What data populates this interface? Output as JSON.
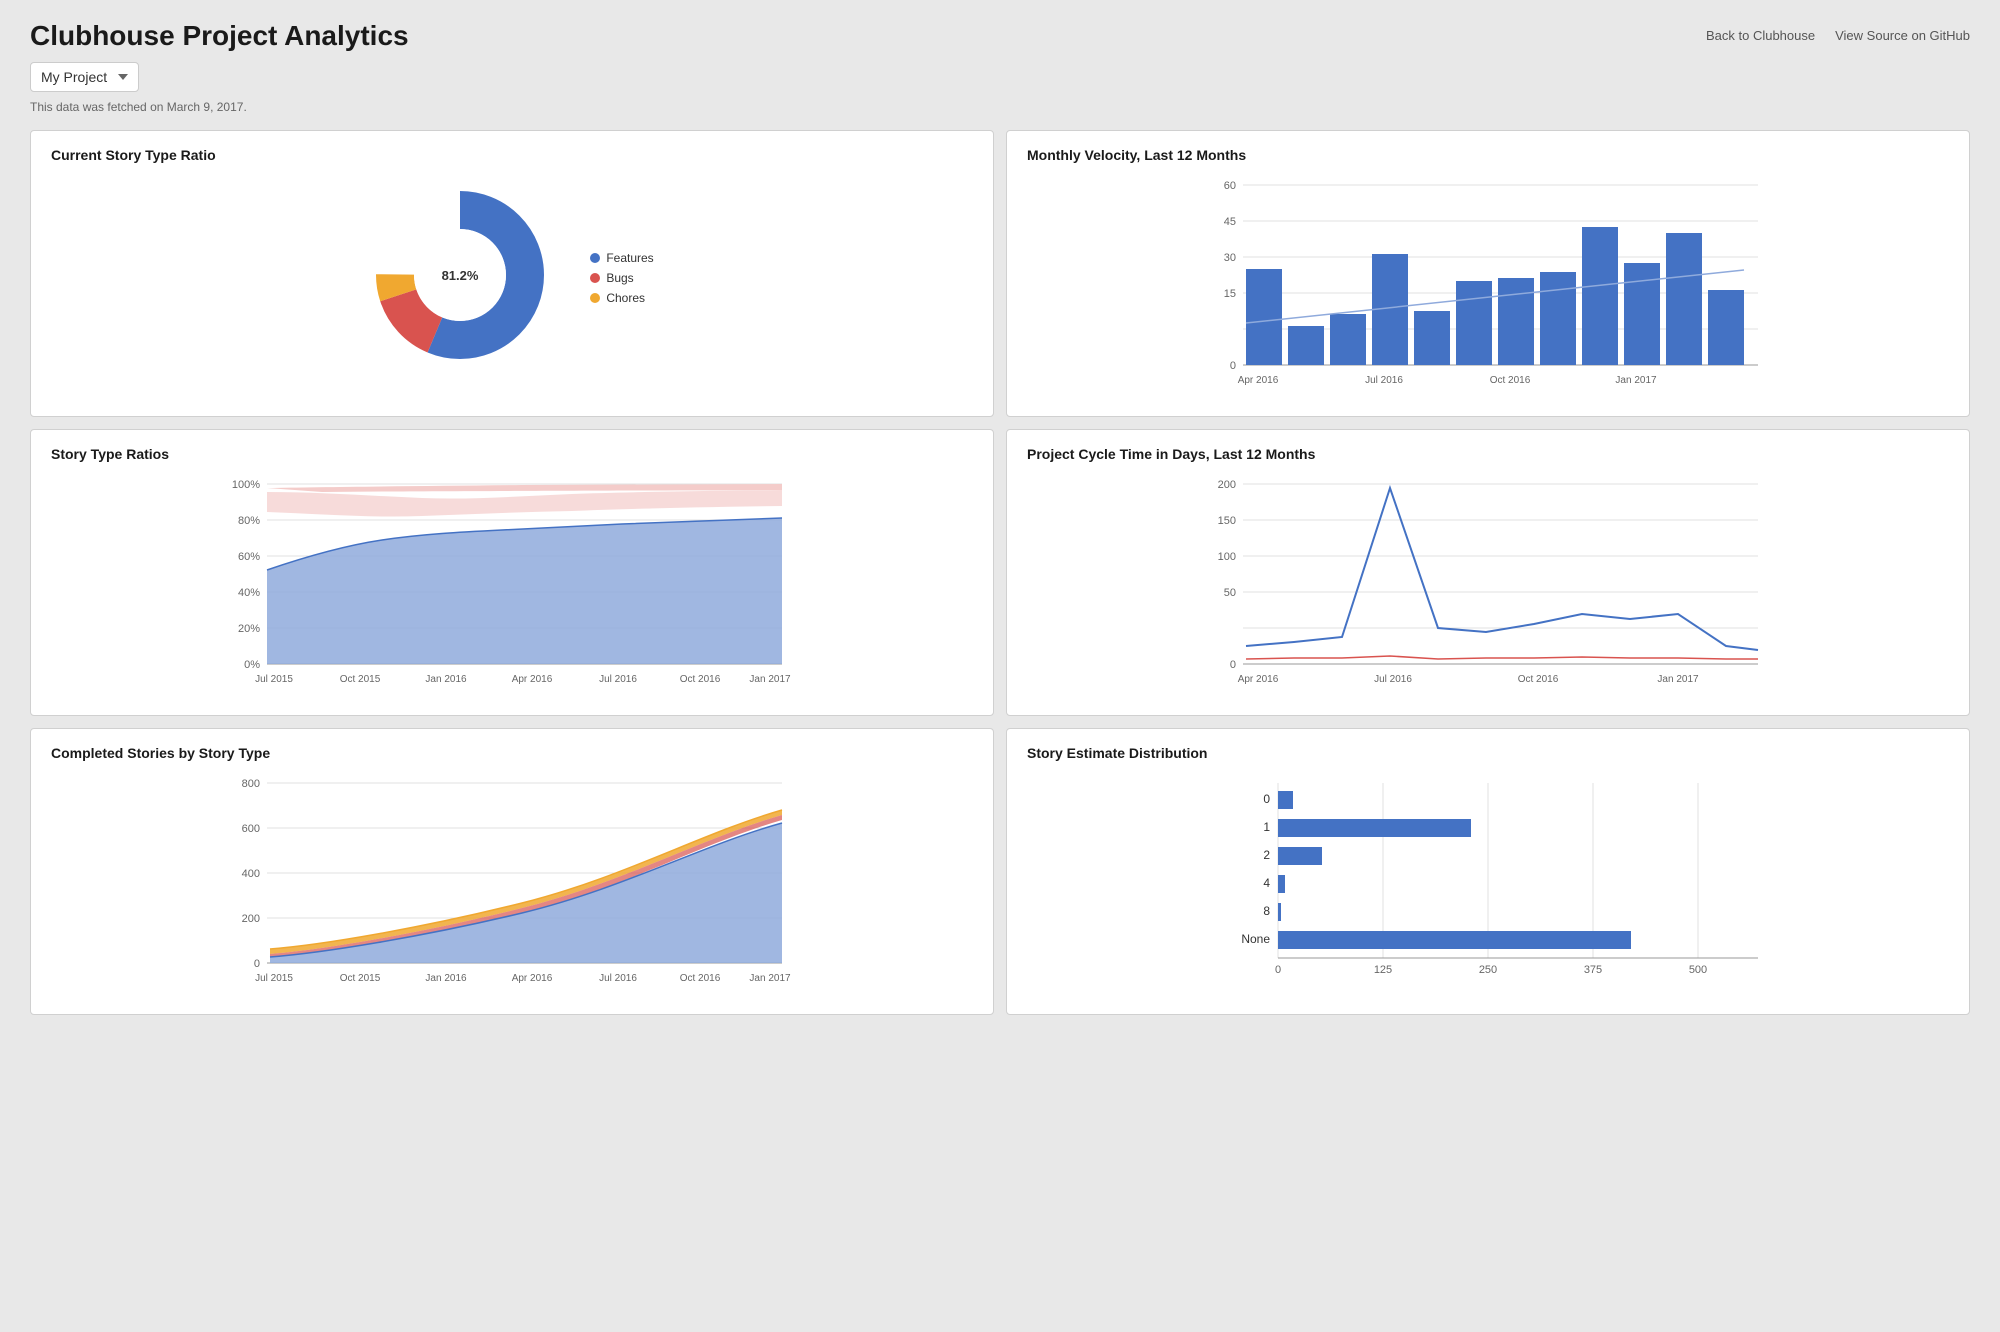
{
  "header": {
    "title": "Clubhouse Project Analytics",
    "back_link": "Back to Clubhouse",
    "github_link": "View Source on GitHub"
  },
  "project_select": {
    "value": "My Project",
    "options": [
      "My Project"
    ]
  },
  "data_date": "This data was fetched on March 9, 2017.",
  "charts": {
    "donut": {
      "title": "Current Story Type Ratio",
      "segments": [
        {
          "label": "Features",
          "value": 81.2,
          "color": "#4472C4"
        },
        {
          "label": "Bugs",
          "value": 13.6,
          "color": "#D9534F"
        },
        {
          "label": "Chores",
          "value": 5.2,
          "color": "#F0A830"
        }
      ],
      "center_label": "81.2%"
    },
    "monthly_velocity": {
      "title": "Monthly Velocity, Last 12 Months",
      "y_max": 60,
      "y_labels": [
        60,
        45,
        30,
        15,
        0
      ],
      "x_labels": [
        "Apr 2016",
        "Jul 2016",
        "Oct 2016",
        "Jan 2017"
      ],
      "bars": [
        32,
        13,
        17,
        37,
        18,
        28,
        29,
        31,
        46,
        34,
        44,
        25
      ]
    },
    "story_type_ratios": {
      "title": "Story Type Ratios",
      "y_labels": [
        "100%",
        "80%",
        "60%",
        "40%",
        "20%",
        "0%"
      ],
      "x_labels": [
        "Jul 2015",
        "Oct 2015",
        "Jan 2016",
        "Apr 2016",
        "Jul 2016",
        "Oct 2016",
        "Jan 2017"
      ]
    },
    "cycle_time": {
      "title": "Project Cycle Time in Days, Last 12 Months",
      "y_max": 200,
      "y_labels": [
        200,
        150,
        100,
        50,
        0
      ],
      "x_labels": [
        "Apr 2016",
        "Jul 2016",
        "Oct 2016",
        "Jan 2017"
      ]
    },
    "completed_stories": {
      "title": "Completed Stories by Story Type",
      "y_labels": [
        800,
        600,
        400,
        200,
        0
      ],
      "x_labels": [
        "Jul 2015",
        "Oct 2015",
        "Jan 2016",
        "Apr 2016",
        "Jul 2016",
        "Oct 2016",
        "Jan 2017"
      ]
    },
    "estimate_distribution": {
      "title": "Story Estimate Distribution",
      "y_labels": [
        "0",
        "1",
        "2",
        "4",
        "8",
        "None"
      ],
      "x_labels": [
        0,
        125,
        250,
        375,
        500
      ],
      "bars": [
        {
          "label": "0",
          "value": 18
        },
        {
          "label": "1",
          "value": 230
        },
        {
          "label": "2",
          "value": 52
        },
        {
          "label": "4",
          "value": 8
        },
        {
          "label": "8",
          "value": 3
        },
        {
          "label": "None",
          "value": 420
        }
      ]
    }
  },
  "colors": {
    "blue": "#4472C4",
    "red": "#D9534F",
    "orange": "#F0A830",
    "blue_light": "#8FAADC",
    "red_light": "#F4CCCA",
    "grid": "#e0e0e0",
    "axis": "#999"
  }
}
